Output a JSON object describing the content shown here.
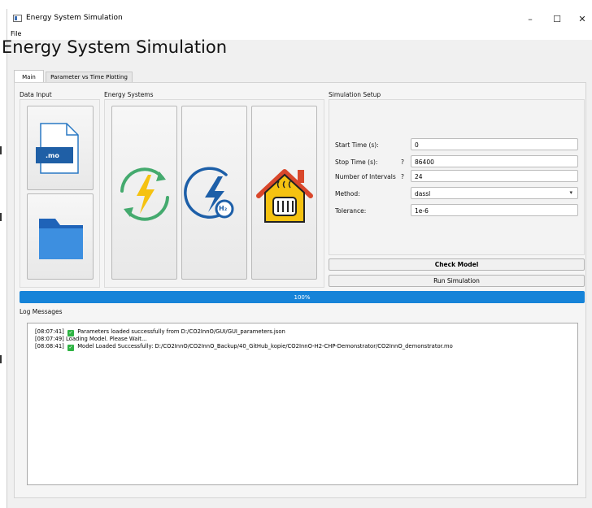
{
  "window": {
    "title": "Energy System Simulation",
    "controls": {
      "minimize": "–",
      "maximize": "☐",
      "close": "✕"
    }
  },
  "menu": {
    "file": "File"
  },
  "app": {
    "heading": "Energy System Simulation"
  },
  "tabs": [
    {
      "label": "Main",
      "active": true
    },
    {
      "label": "Parameter vs Time Plotting",
      "active": false
    }
  ],
  "sections": {
    "data_input": "Data Input",
    "energy_systems": "Energy Systems",
    "simulation_setup": "Simulation Setup",
    "log_messages": "Log Messages"
  },
  "data_input": {
    "mo_file_badge": ".mo",
    "mo_file_icon": "mo-file-icon",
    "folder_icon": "folder-icon"
  },
  "energy_systems": {
    "icons": [
      "power-cycle-icon",
      "hydrogen-energy-icon",
      "house-heating-icon"
    ],
    "h2_badge": "H₂"
  },
  "simulation_setup": {
    "start_time": {
      "label": "Start Time (s):",
      "hint": "",
      "value": "0"
    },
    "stop_time": {
      "label": "Stop Time (s):",
      "hint": "?",
      "value": "86400"
    },
    "intervals": {
      "label": "Number of Intervals",
      "hint": "?",
      "value": "24"
    },
    "method": {
      "label": "Method:",
      "value": "dassl"
    },
    "tolerance": {
      "label": "Tolerance:",
      "value": "1e-6"
    },
    "check_model": "Check Model",
    "run_simulation": "Run Simulation"
  },
  "progress": {
    "value": 1.0,
    "label": "100%"
  },
  "log": {
    "lines": [
      {
        "time": "[08:07:41]",
        "ok": true,
        "text": "Parameters loaded successfully from D:/CO2InnO/GUI/GUI_parameters.json"
      },
      {
        "time": "[08:07:49]",
        "ok": false,
        "text": "Loading Model. Please Wait..."
      },
      {
        "time": "[08:08:41]",
        "ok": true,
        "text": "Model Loaded Successfully: D:/CO2InnO/CO2InnO_Backup/40_GitHub_kopie/CO2InnO-H2-CHP-Demonstrator/CO2InnO_demonstrator.mo"
      }
    ]
  },
  "colors": {
    "accent": "#1683d8",
    "file_blue": "#2a79c4",
    "folder_blue": "#3d8fe0",
    "cycle_green": "#44aa6e",
    "bolt_yellow": "#f5c211",
    "h2_blue": "#1d5fa8",
    "house_red": "#d9472b",
    "check_green": "#2fb344"
  }
}
